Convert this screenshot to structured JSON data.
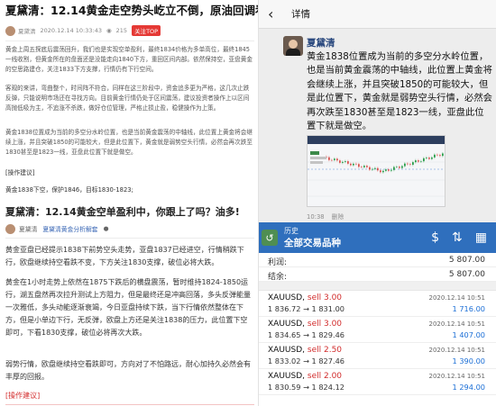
{
  "article": {
    "title": "夏黛清：12.14黄金走空势头屹立不倒，原油回调看涨!",
    "meta": {
      "author": "夏黛清",
      "time": "2020.12.14 10:33:43",
      "views": "215",
      "tag": "关注TOP"
    },
    "paras": [
      "黄金上周五探底后震荡回升，我们也是实现空单盈利，最终1834价格为多单高位，最终1845一线收割，但黄金所在的盘面还是没能走向1840下方，重回区间内部。依然保持空，亚盘黄金的空思路建仓，关注1833下方支撑，行情仍有下行空间。",
      "客观的来讲，弯曲整个，时间阵不符合，同样在这三阶段中，资金追多更为严格，这几次止跌反弹，只能说明市场还在寻找方向。目前黄金行情仍处于区间震荡，建议投资者操作上以区间高抛低吸为主，不追涨不杀跌，做好仓位管理，严格止损止盈，稳健操作为上策。",
      "黄金1838位置成为当前的多空分水岭位置，也是当前黄金震荡的中轴线，此位置上黄金将会继续上涨，并且突破1850的可能较大，但是此位置下，黄金就是弱势空头行情，必然会再次跌至1830甚至是1823一线，亚盘此位置下就是做空。"
    ],
    "section": "[操作建议]",
    "suggestion": "黄金1838下空，保护1846，目标1830-1823;",
    "title2": "夏黛清：12.14黄金空单盈利中，你跟上了吗？油多!",
    "meta2": {
      "author": "夏黛清",
      "link": "夏黛清黄金分析解套",
      "dot": "●"
    },
    "paras2": [
      "黄金亚盘已经提示1838下前势空头走势，亚盘1837已经进空，行情稍跌下行，欧盘继续持空看跌不变，下方关注1830支撑，破位必将大跌。",
      "黄金在1小时走势上依然在1875下跌后的横盘震荡，暂时维持1824-1850运行，湖五盘然再次拉升测试上方阻力，但是最终还是冲高回落，多头反弹能量一次雅低，多头动能逐渐衰竭，今日亚盘持续下跌，当下行情依然整体在下方，但是小单边下行，无反弹，欧盘上方还是关注1838的压力，此位置下空即可，下看1830支撑，破位必将再次大跌。",
      "弱势行情，欧盘继续持空看跌即可，方向对了不怕路远，耐心加持久必然会有丰厚的回报。"
    ],
    "section2": "[操作建议]",
    "suggestion2": "黄金1838下空，保护1843，目标1825;"
  },
  "chat": {
    "back_icon": "‹",
    "title": "详情",
    "sender": "夏黛清",
    "message": "黄金1838位置成为当前的多空分水岭位置，也是当前黄金震荡的中轴线，此位置上黄金将会继续上涨，并且突破1850的可能较大，但是此位置下，黄金就是弱势空头行情，必然会再次跌至1830甚至是1823一线，亚盘此位置下就是做空。",
    "time": "10:38",
    "delete_label": "删除"
  },
  "trades": {
    "header": {
      "small": "历史",
      "big": "全部交易品种"
    },
    "icons": [
      "history-icon",
      "dollar-swap-icon",
      "sort-icon",
      "calendar-icon"
    ],
    "icon_glyphs": {
      "swap": "$",
      "sort": "⇅",
      "cal": "▦"
    },
    "summary": [
      {
        "label": "利润:",
        "value": "5 807.00"
      },
      {
        "label": "结余:",
        "value": "5 807.00"
      }
    ],
    "rows": [
      {
        "symbol": "XAUUSD,",
        "side": "sell 3.00",
        "prices": "1 836.72 → 1 831.00",
        "date": "2020.12.14 10:51",
        "profit": "1 716.00"
      },
      {
        "symbol": "XAUUSD,",
        "side": "sell 3.00",
        "prices": "1 834.65 → 1 829.46",
        "date": "2020.12.14 10:51",
        "profit": "1 407.00"
      },
      {
        "symbol": "XAUUSD,",
        "side": "sell 2.50",
        "prices": "1 833.02 → 1 827.46",
        "date": "2020.12.14 10:51",
        "profit": "1 390.00"
      },
      {
        "symbol": "XAUUSD,",
        "side": "sell 2.00",
        "prices": "1 830.59 → 1 824.12",
        "date": "2020.12.14 10:51",
        "profit": "1 294.00"
      }
    ]
  },
  "colors": {
    "header_blue": "#2f6fbd",
    "sell_red": "#d12b2b",
    "profit_blue": "#1c6fd6",
    "sender_blue": "#2c4a7f"
  }
}
